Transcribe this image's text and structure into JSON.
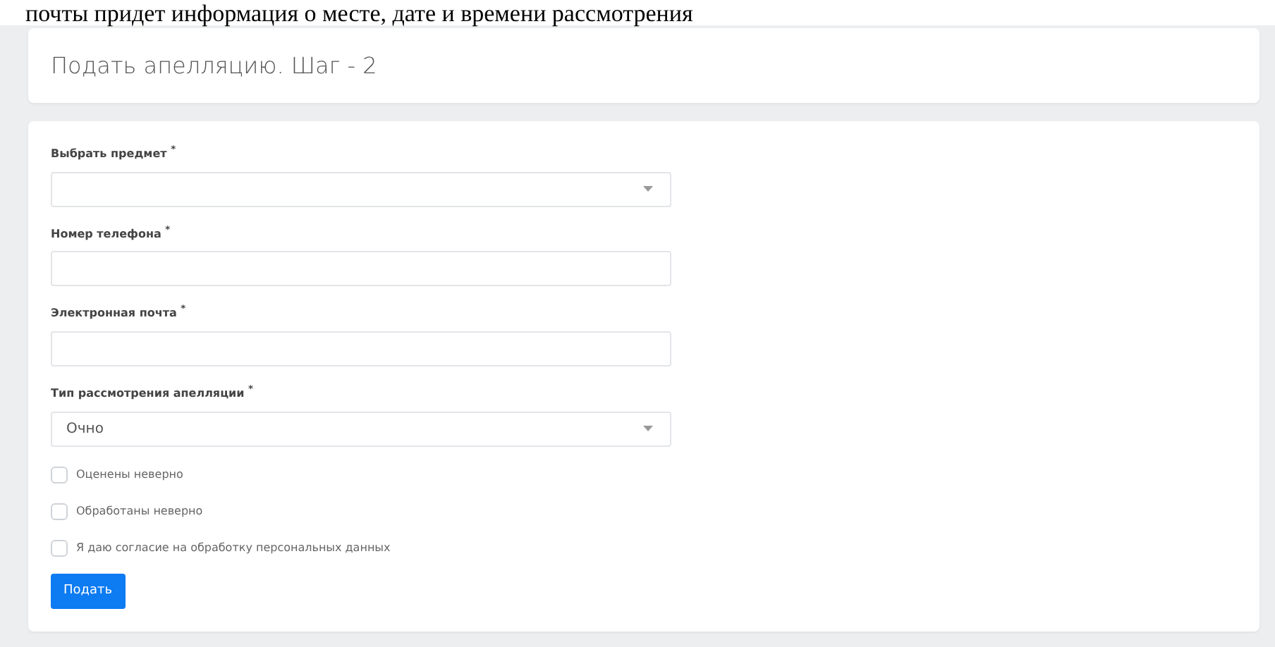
{
  "document_text": "почты придет информация о месте, дате и времени рассмотрения",
  "header": {
    "title": "Подать апелляцию. Шаг - 2"
  },
  "form": {
    "fields": [
      {
        "kind": "select",
        "label": "Выбрать предмет $^{*}$"
      },
      {
        "kind": "text",
        "label": "Номер телефона $^{*}$"
      },
      {
        "kind": "text",
        "label": "Электронная почта $^{*}$"
      },
      {
        "kind": "select",
        "label": "Тип рассмотрения апелляции $^{*}$",
        "value": "Очно"
      }
    ],
    "checkboxes": [
      {
        "label": "Оценены неверно",
        "checked": false
      },
      {
        "label": "Обработаны неверно",
        "checked": false
      },
      {
        "label": "Я даю согласие на обработку персональных данных",
        "checked": false
      }
    ],
    "submit": "Подать"
  }
}
